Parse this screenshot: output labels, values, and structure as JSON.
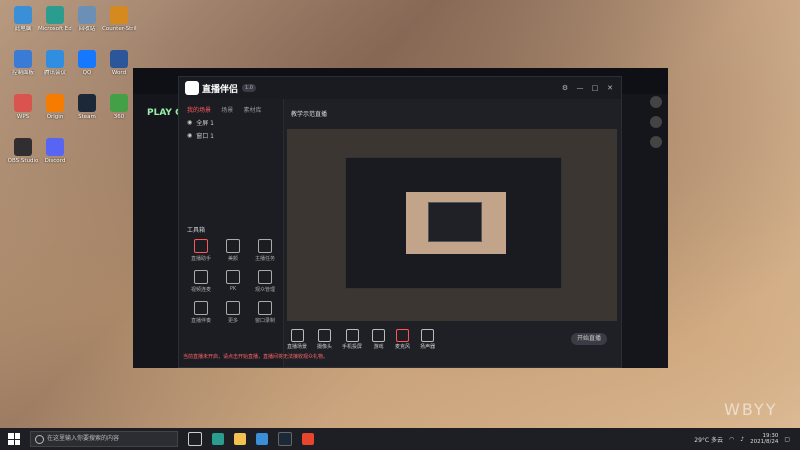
{
  "desktop": {
    "icons": [
      {
        "label": "此电脑",
        "color": "#3b8fd6"
      },
      {
        "label": "Microsoft Edge",
        "color": "#2a9d8f"
      },
      {
        "label": "回收站",
        "color": "#6c8fb5"
      },
      {
        "label": "Counter-Strike",
        "color": "#d48a1e"
      },
      {
        "label": "控制面板",
        "color": "#3a7bd5"
      },
      {
        "label": "腾讯会议",
        "color": "#2f8ee0"
      },
      {
        "label": "QQ",
        "color": "#1677ff"
      },
      {
        "label": "Word",
        "color": "#2b579a"
      },
      {
        "label": "WPS",
        "color": "#d9534f"
      },
      {
        "label": "Origin",
        "color": "#f57c00"
      },
      {
        "label": "Steam",
        "color": "#1b2838"
      },
      {
        "label": "360",
        "color": "#43a047"
      },
      {
        "label": "OBS Studio",
        "color": "#302e31"
      },
      {
        "label": "Discord",
        "color": "#5865f2"
      }
    ],
    "watermark": "WBYY"
  },
  "under_app": {
    "logo_text": "PLAY C"
  },
  "window": {
    "title": "直播伴侣",
    "version": "1.0",
    "tabs": [
      "我的场景",
      "场景",
      "素材库"
    ],
    "scenes": [
      "全屏 1",
      "窗口 1"
    ],
    "preview_title": "教学示范直播",
    "tool_section": "工具箱",
    "tools": [
      "直播助手",
      "美颜",
      "主播任务",
      "视频连麦",
      "PK",
      "观众管理",
      "直播伴奏",
      "更多",
      "窗口录制"
    ],
    "bottom_buttons": [
      "直播场景",
      "摄像头",
      "手机投屏",
      "游戏",
      "麦克风",
      "扬声器"
    ],
    "start_label": "开始直播",
    "status_text": "当前直播未开启，请点击开始直播，直播间将无法接收观众礼物。"
  },
  "taskbar": {
    "search_placeholder": "在这里输入你要搜索的内容",
    "weather": "29°C 多云",
    "time": "19:30",
    "date": "2021/8/24"
  }
}
